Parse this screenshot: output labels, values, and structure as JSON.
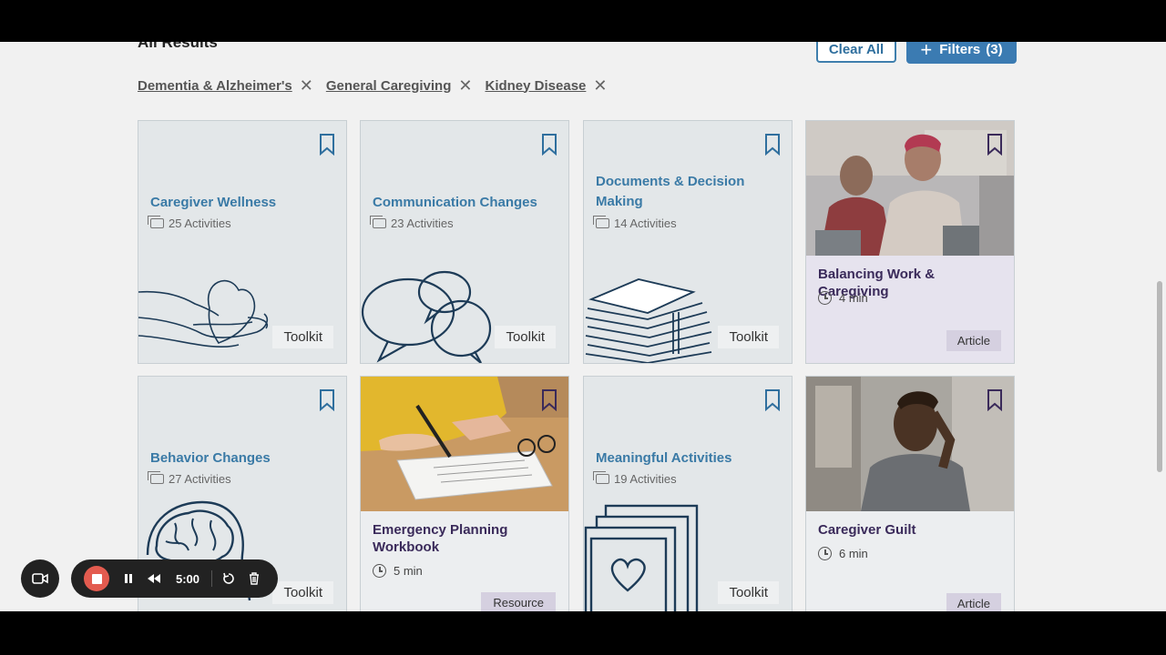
{
  "header": {
    "heading": "All Results",
    "clear_all_label": "Clear All",
    "filters_label": "Filters",
    "filters_count": "(3)"
  },
  "filter_chips": [
    {
      "label": "Dementia & Alzheimer's"
    },
    {
      "label": "General Caregiving"
    },
    {
      "label": "Kidney Disease"
    }
  ],
  "cards": [
    {
      "title": "Caregiver Wellness",
      "meta": "25 Activities",
      "type": "Toolkit",
      "icon": "hands-heart-illustration"
    },
    {
      "title": "Communication Changes",
      "meta": "23 Activities",
      "type": "Toolkit",
      "icon": "speech-bubbles-illustration"
    },
    {
      "title": "Documents & Decision Making",
      "meta": "14 Activities",
      "type": "Toolkit",
      "icon": "paper-stack-illustration"
    },
    {
      "title": "Balancing Work & Caregiving",
      "meta": "4 min",
      "type": "Article",
      "icon": "office-meeting-photo"
    },
    {
      "title": "Behavior Changes",
      "meta": "27 Activities",
      "type": "Toolkit",
      "icon": "brain-head-illustration"
    },
    {
      "title": "Emergency Planning Workbook",
      "meta": "5 min",
      "type": "Resource",
      "icon": "writing-clipboard-photo"
    },
    {
      "title": "Meaningful Activities",
      "meta": "19 Activities",
      "type": "Toolkit",
      "icon": "heart-frames-illustration"
    },
    {
      "title": "Caregiver Guilt",
      "meta": "6 min",
      "type": "Article",
      "icon": "stressed-man-photo"
    }
  ],
  "recorder": {
    "time": "5:00"
  },
  "colors": {
    "accent": "#3b7bb2",
    "title_blue": "#3a7aa6",
    "article_title": "#3a2a5a",
    "record_red": "#e35b4f"
  }
}
